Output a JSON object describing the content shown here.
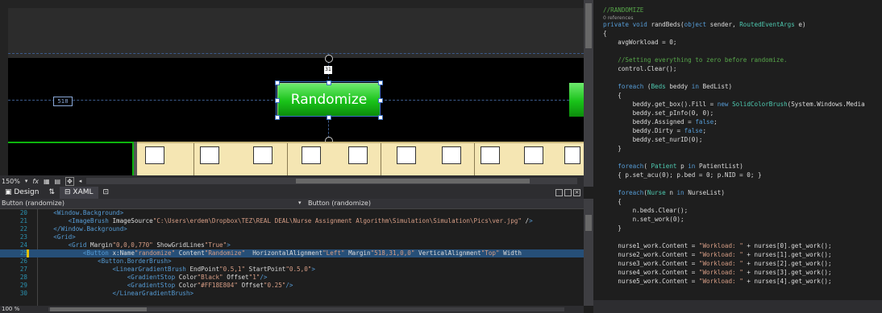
{
  "design": {
    "button_label": "Randomize",
    "margin_value": "518",
    "top_value": "31",
    "beds_count": 10
  },
  "toolbar": {
    "zoom": "150%",
    "fx": "fx"
  },
  "tabs": {
    "design": "Design",
    "swap": "⇅",
    "xaml": "XAML"
  },
  "nav": {
    "left": "Button (randomize)",
    "right": "Button (randomize)"
  },
  "xaml_lines": [
    {
      "n": "20",
      "code": "    <Window.Background>"
    },
    {
      "n": "21",
      "code": "        <ImageBrush ImageSource=\"C:\\Users\\erdem\\Dropbox\\TEZ\\REAL DEAL\\Nurse Assignment Algorithm\\Simulation\\Simulation\\Pics\\ver.jpg\" />"
    },
    {
      "n": "22",
      "code": "    </Window.Background>"
    },
    {
      "n": "23",
      "code": "    <Grid>"
    },
    {
      "n": "24",
      "code": "        <Grid Margin=\"0,0,0,770\" ShowGridLines=\"True\">"
    },
    {
      "n": "25",
      "code": "            <Button x:Name=\"randomize\" Content=\"Randomize\"  HorizontalAlignment=\"Left\" Margin=\"518,31,0,0\" VerticalAlignment=\"Top\" Width="
    },
    {
      "n": "26",
      "code": "                <Button.BorderBrush>"
    },
    {
      "n": "27",
      "code": "                    <LinearGradientBrush EndPoint=\"0.5,1\" StartPoint=\"0.5,0\">"
    },
    {
      "n": "28",
      "code": "                        <GradientStop Color=\"Black\" Offset=\"1\"/>"
    },
    {
      "n": "29",
      "code": "                        <GradientStop Color=\"#FF18E804\" Offset=\"0.25\"/>"
    },
    {
      "n": "30",
      "code": "                    </LinearGradientBrush>"
    }
  ],
  "bottom": {
    "zoom": "100 %"
  },
  "csharp_lines": [
    {
      "cls": "cm",
      "code": "//RANDOMIZE"
    },
    {
      "cls": "ref",
      "code": "0 references"
    },
    {
      "cls": "mix",
      "code": "private void randBeds(object sender, RoutedEventArgs e)"
    },
    {
      "cls": "tx",
      "code": "{"
    },
    {
      "cls": "tx",
      "code": "    avgWorkload = 0;"
    },
    {
      "cls": "tx",
      "code": ""
    },
    {
      "cls": "cm",
      "code": "    //Setting everything to zero before randomize."
    },
    {
      "cls": "tx",
      "code": "    control.Clear();"
    },
    {
      "cls": "tx",
      "code": ""
    },
    {
      "cls": "mix",
      "code": "    foreach (Beds beddy in BedList)"
    },
    {
      "cls": "tx",
      "code": "    {"
    },
    {
      "cls": "mix",
      "code": "        beddy.get_box().Fill = new SolidColorBrush(System.Windows.Media"
    },
    {
      "cls": "tx",
      "code": "        beddy.set_pInfo(0, 0);"
    },
    {
      "cls": "mix",
      "code": "        beddy.Assigned = false;"
    },
    {
      "cls": "mix",
      "code": "        beddy.Dirty = false;"
    },
    {
      "cls": "tx",
      "code": "        beddy.set_nurID(0);"
    },
    {
      "cls": "tx",
      "code": "    }"
    },
    {
      "cls": "tx",
      "code": ""
    },
    {
      "cls": "mix",
      "code": "    foreach( Patient p in PatientList)"
    },
    {
      "cls": "tx",
      "code": "    { p.set_acu(0); p.bed = 0; p.NID = 0; }"
    },
    {
      "cls": "tx",
      "code": ""
    },
    {
      "cls": "mix",
      "code": "    foreach(Nurse n in NurseList)"
    },
    {
      "cls": "tx",
      "code": "    {"
    },
    {
      "cls": "tx",
      "code": "        n.beds.Clear();"
    },
    {
      "cls": "tx",
      "code": "        n.set_work(0);"
    },
    {
      "cls": "tx",
      "code": "    }"
    },
    {
      "cls": "tx",
      "code": ""
    },
    {
      "cls": "mix",
      "code": "    nurse1_work.Content = \"Workload: \" + nurses[0].get_work();"
    },
    {
      "cls": "mix",
      "code": "    nurse2_work.Content = \"Workload: \" + nurses[1].get_work();"
    },
    {
      "cls": "mix",
      "code": "    nurse3_work.Content = \"Workload: \" + nurses[2].get_work();"
    },
    {
      "cls": "mix",
      "code": "    nurse4_work.Content = \"Workload: \" + nurses[3].get_work();"
    },
    {
      "cls": "mix",
      "code": "    nurse5_work.Content = \"Workload: \" + nurses[4].get_work();"
    }
  ]
}
